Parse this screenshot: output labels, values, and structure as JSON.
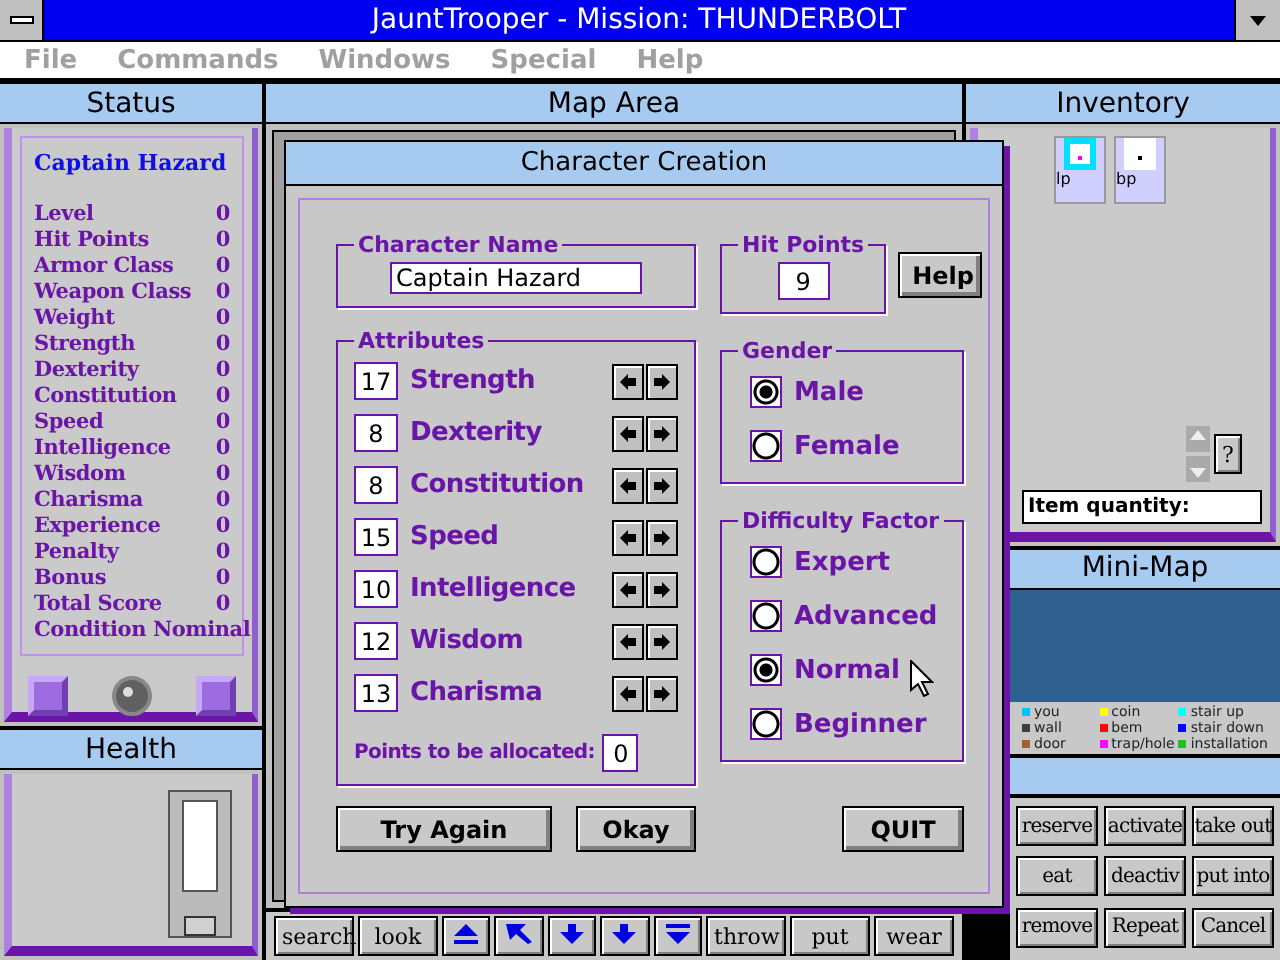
{
  "window": {
    "title": "JauntTrooper - Mission: THUNDERBOLT"
  },
  "menu": [
    "File",
    "Commands",
    "Windows",
    "Special",
    "Help"
  ],
  "status": {
    "title": "Status",
    "character": "Captain Hazard",
    "stats": [
      {
        "label": "Level",
        "value": "0"
      },
      {
        "label": "Hit Points",
        "value": "0"
      },
      {
        "label": "Armor Class",
        "value": "0"
      },
      {
        "label": "Weapon Class",
        "value": "0"
      },
      {
        "label": "Weight",
        "value": "0"
      },
      {
        "label": "Strength",
        "value": "0"
      },
      {
        "label": "Dexterity",
        "value": "0"
      },
      {
        "label": "Constitution",
        "value": "0"
      },
      {
        "label": "Speed",
        "value": "0"
      },
      {
        "label": "Intelligence",
        "value": "0"
      },
      {
        "label": "Wisdom",
        "value": "0"
      },
      {
        "label": "Charisma",
        "value": "0"
      },
      {
        "label": "Experience",
        "value": "0"
      },
      {
        "label": "Penalty",
        "value": "0"
      },
      {
        "label": "Bonus",
        "value": "0"
      },
      {
        "label": "Total Score",
        "value": "0"
      }
    ],
    "condition": "Condition Nominal"
  },
  "health": {
    "title": "Health",
    "level": 0
  },
  "map_area": {
    "title": "Map Area"
  },
  "inventory": {
    "title": "Inventory",
    "items": [
      {
        "label": "lp"
      },
      {
        "label": "bp"
      }
    ],
    "quantity_label": "Item quantity:",
    "help": "?"
  },
  "minimap": {
    "title": "Mini-Map",
    "legend": [
      {
        "label": "you",
        "color": "#00c0ff"
      },
      {
        "label": "coin",
        "color": "#ffff00"
      },
      {
        "label": "stair up",
        "color": "#00ffff"
      },
      {
        "label": "wall",
        "color": "#404040"
      },
      {
        "label": "bem",
        "color": "#ff0000"
      },
      {
        "label": "stair down",
        "color": "#0000ff"
      },
      {
        "label": "door",
        "color": "#a06030"
      },
      {
        "label": "trap/hole",
        "color": "#ff00ff"
      },
      {
        "label": "installation",
        "color": "#20c020"
      }
    ]
  },
  "toolbar": {
    "left_buttons": [
      "search",
      "look"
    ],
    "right_buttons": [
      "throw",
      "put",
      "wear"
    ]
  },
  "action_buttons": [
    "reserve",
    "activate",
    "take out",
    "eat",
    "deactiv",
    "put into",
    "remove",
    "Repeat",
    "Cancel"
  ],
  "dialog": {
    "title": "Character Creation",
    "name_label": "Character Name",
    "name_value": "Captain Hazard",
    "hit_points_label": "Hit Points",
    "hit_points": "9",
    "help": "Help",
    "attributes_label": "Attributes",
    "attributes": [
      {
        "value": "17",
        "name": "Strength"
      },
      {
        "value": "8",
        "name": "Dexterity"
      },
      {
        "value": "8",
        "name": "Constitution"
      },
      {
        "value": "15",
        "name": "Speed"
      },
      {
        "value": "10",
        "name": "Intelligence"
      },
      {
        "value": "12",
        "name": "Wisdom"
      },
      {
        "value": "13",
        "name": "Charisma"
      }
    ],
    "points_label": "Points to be allocated:",
    "points": "0",
    "gender_label": "Gender",
    "gender": [
      {
        "label": "Male",
        "selected": true
      },
      {
        "label": "Female",
        "selected": false
      }
    ],
    "difficulty_label": "Difficulty Factor",
    "difficulty": [
      {
        "label": "Expert",
        "selected": false
      },
      {
        "label": "Advanced",
        "selected": false
      },
      {
        "label": "Normal",
        "selected": true
      },
      {
        "label": "Beginner",
        "selected": false
      }
    ],
    "buttons": [
      "Try Again",
      "Okay",
      "QUIT"
    ]
  }
}
